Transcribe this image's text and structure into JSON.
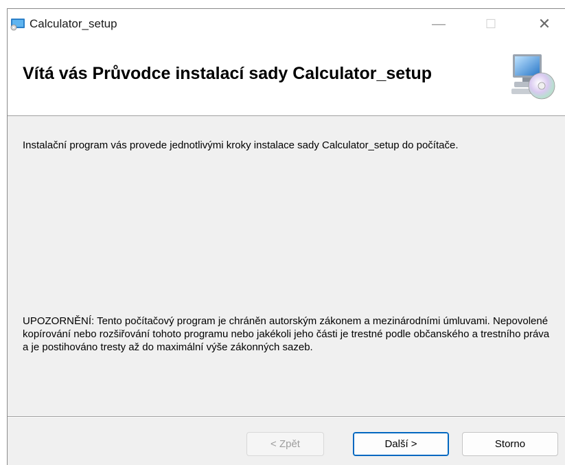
{
  "window": {
    "title": "Calculator_setup",
    "controls": {
      "minimize": "—",
      "maximize": "☐",
      "close": "✕"
    }
  },
  "header": {
    "title": "Vítá vás Průvodce instalací sady Calculator_setup",
    "icon": "computer-cd-icon"
  },
  "content": {
    "intro": "Instalační program vás provede jednotlivými kroky instalace sady Calculator_setup do počítače.",
    "notice": "UPOZORNĚNÍ: Tento počítačový program je chráněn autorským zákonem a mezinárodními úmluvami. Nepovolené kopírování nebo rozšiřování tohoto programu nebo jakékoli jeho části je trestné podle občanského a trestního práva a je postihováno tresty až do maximální výše zákonných sazeb."
  },
  "buttons": {
    "back": "< Zpět",
    "next": "Další >",
    "cancel": "Storno"
  },
  "colors": {
    "accent": "#0067c0",
    "dialog_bg": "#f0f0f0",
    "disabled_text": "#9d9d9d"
  }
}
